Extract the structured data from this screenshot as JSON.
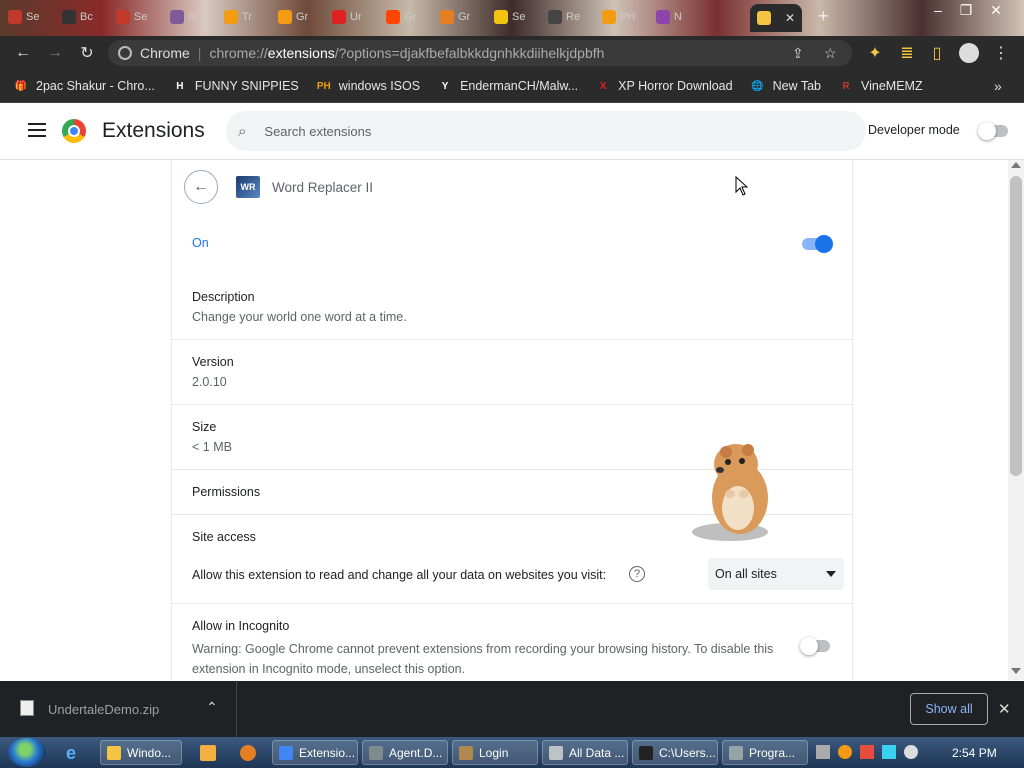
{
  "browser": {
    "tabs": [
      {
        "title": "Se",
        "color": "#c0392b"
      },
      {
        "title": "Bc",
        "color": "#333333"
      },
      {
        "title": "Se",
        "color": "#c0392b"
      },
      {
        "title": "N",
        "color": "#7f5a9a"
      },
      {
        "title": "Tr",
        "color": "#f39c12"
      },
      {
        "title": "Gr",
        "color": "#f39c12"
      },
      {
        "title": "Ur",
        "color": "#e02020"
      },
      {
        "title": "Gr",
        "color": "#ff4500"
      },
      {
        "title": "Gr",
        "color": "#e67e22"
      },
      {
        "title": "Se",
        "color": "#f1c40f"
      },
      {
        "title": "Re",
        "color": "#444444"
      },
      {
        "title": "PH",
        "color": "#f39c12"
      },
      {
        "title": "N",
        "color": "#8e44ad"
      }
    ],
    "active_tab_close": "✕",
    "new_tab": "+",
    "address": {
      "site_label": "Chrome",
      "url_prefix": "chrome://",
      "url_host": "extensions",
      "url_rest": "/?options=djakfbefalbkkdgnhkkdiihelkjdpbfh"
    },
    "bookmarks": [
      {
        "label": "2pac Shakur - Chro...",
        "icon": "🎁",
        "color": "#c0392b"
      },
      {
        "label": "FUNNY SNIPPIES",
        "icon": "H",
        "color": "#ffffff"
      },
      {
        "label": "windows ISOS",
        "icon": "PH",
        "color": "#f39c12"
      },
      {
        "label": "EndermanCH/Malw...",
        "icon": "Y",
        "color": "#ffffff"
      },
      {
        "label": "XP Horror Download",
        "icon": "X",
        "color": "#e02020"
      },
      {
        "label": "New Tab",
        "icon": "🌐",
        "color": "#aaaaaa"
      },
      {
        "label": "VineMEMZ",
        "icon": "R",
        "color": "#c0392b"
      }
    ],
    "bookmarks_more": "»"
  },
  "extensions_page": {
    "title": "Extensions",
    "search_placeholder": "Search extensions",
    "developer_mode_label": "Developer mode",
    "developer_mode_on": false
  },
  "extension": {
    "name": "Word Replacer II",
    "icon_text": "WR",
    "enabled_label": "On",
    "enabled": true,
    "description_label": "Description",
    "description": "Change your world one word at a time.",
    "version_label": "Version",
    "version": "2.0.10",
    "size_label": "Size",
    "size": "< 1 MB",
    "permissions_label": "Permissions",
    "site_access_label": "Site access",
    "site_access_text": "Allow this extension to read and change all your data on websites you visit:",
    "site_access_value": "On all sites",
    "incognito_label": "Allow in Incognito",
    "incognito_warning": "Warning: Google Chrome cannot prevent extensions from recording your browsing history. To disable this extension in Incognito mode, unselect this option.",
    "incognito_on": false
  },
  "download_bar": {
    "file": "UndertaleDemo.zip",
    "show_all": "Show all"
  },
  "taskbar": {
    "buttons": [
      {
        "label": "Windo...",
        "color": "#f5c542"
      },
      {
        "label": "Extensio...",
        "color": "#4285f4"
      },
      {
        "label": "Agent.D...",
        "color": "#7f8c8d"
      },
      {
        "label": "Login",
        "color": "#b08850"
      },
      {
        "label": "All Data ...",
        "color": "#bdc3c7"
      },
      {
        "label": "C:\\Users...",
        "color": "#222222"
      },
      {
        "label": "Progra...",
        "color": "#95a5a6"
      }
    ],
    "clock": "2:54 PM"
  },
  "colors": {
    "accent": "#1a73e8",
    "toggle_track_on": "#8ab4f8",
    "download_bg": "#202124",
    "toolbar_bg": "#2b2b2b"
  }
}
